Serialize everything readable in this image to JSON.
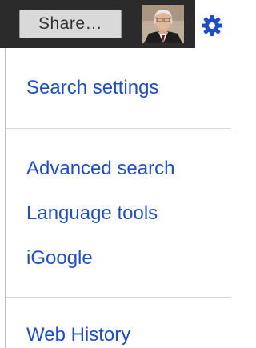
{
  "header": {
    "share_label": "Share…"
  },
  "icons": {
    "gear": "gear-icon",
    "avatar": "avatar"
  },
  "menu": {
    "items": [
      {
        "label": "Search settings"
      },
      {
        "label": "Advanced search"
      },
      {
        "label": "Language tools"
      },
      {
        "label": "iGoogle"
      },
      {
        "label": "Web History"
      }
    ]
  },
  "colors": {
    "bar": "#2b2b2b",
    "link": "#1f4ec2",
    "gear": "#1f4ec2"
  }
}
